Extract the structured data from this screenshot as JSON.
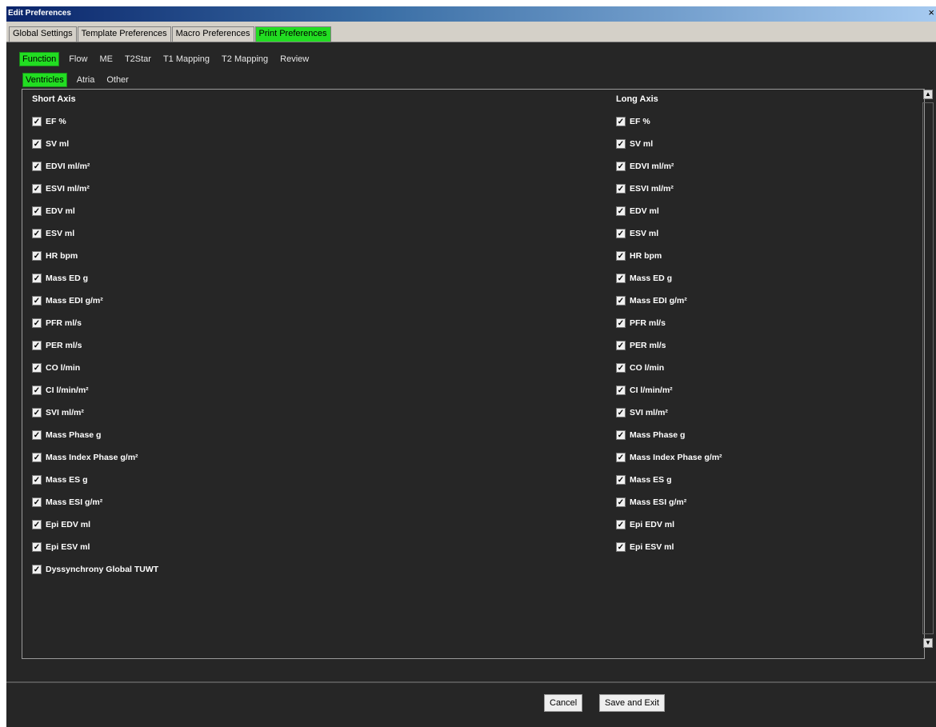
{
  "window": {
    "title": "Edit Preferences",
    "close_glyph": "×"
  },
  "top_tabs": [
    "Global Settings",
    "Template Preferences",
    "Macro Preferences",
    "Print Preferences"
  ],
  "sub_tabs": [
    "Function",
    "Flow",
    "ME",
    "T2Star",
    "T1 Mapping",
    "T2 Mapping",
    "Review"
  ],
  "sub_sub_tabs": [
    "Ventricles",
    "Atria",
    "Other"
  ],
  "columns": {
    "short_axis": {
      "title": "Short Axis",
      "items": [
        "EF %",
        "SV ml",
        "EDVI ml/m²",
        "ESVI ml/m²",
        "EDV ml",
        "ESV ml",
        "HR bpm",
        "Mass ED g",
        "Mass EDI g/m²",
        "PFR ml/s",
        "PER ml/s",
        "CO l/min",
        "CI l/min/m²",
        "SVI ml/m²",
        "Mass Phase g",
        "Mass Index Phase g/m²",
        "Mass ES g",
        "Mass ESI g/m²",
        "Epi EDV ml",
        "Epi ESV ml",
        "Dyssynchrony Global TUWT"
      ]
    },
    "long_axis": {
      "title": "Long Axis",
      "items": [
        "EF %",
        "SV ml",
        "EDVI ml/m²",
        "ESVI ml/m²",
        "EDV ml",
        "ESV ml",
        "HR bpm",
        "Mass ED g",
        "Mass EDI g/m²",
        "PFR ml/s",
        "PER ml/s",
        "CO l/min",
        "CI l/min/m²",
        "SVI ml/m²",
        "Mass Phase g",
        "Mass Index Phase g/m²",
        "Mass ES g",
        "Mass ESI g/m²",
        "Epi EDV ml",
        "Epi ESV ml"
      ]
    }
  },
  "check_glyph": "✓",
  "scroll_up_glyph": "▲",
  "scroll_down_glyph": "▼",
  "buttons": {
    "cancel": "Cancel",
    "save": "Save and Exit"
  },
  "colors": {
    "active_tab": "#22dd22",
    "background": "#262626"
  }
}
